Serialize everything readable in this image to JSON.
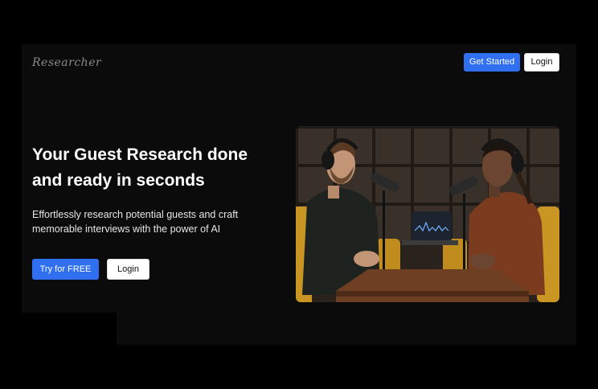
{
  "header": {
    "logo_text": "Researcher",
    "get_started_label": "Get Started",
    "login_label": "Login"
  },
  "hero": {
    "headline_line1": "Your Guest Research done",
    "headline_line2": "and ready in seconds",
    "subtext_line1": "Effortlessly research potential guests and craft",
    "subtext_line2": "memorable interviews with the power of AI",
    "cta_primary_label": "Try for FREE",
    "cta_secondary_label": "Login"
  },
  "colors": {
    "background": "#0b0b0b",
    "accent": "#2f6ff0",
    "text": "#ffffff"
  }
}
